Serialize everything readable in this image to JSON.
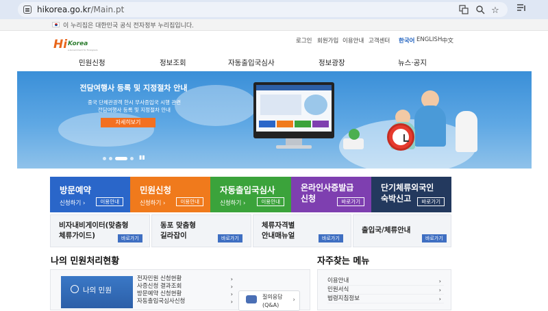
{
  "browser": {
    "url_host": "hikorea.go.kr",
    "url_path": "/Main.pt"
  },
  "gov_notice": "이 누리집은 대한민국 공식 전자정부 누리집입니다.",
  "logo": {
    "hi": "Hi",
    "korea": "Korea",
    "sub": "e-Government for Foreigners"
  },
  "util_links": [
    "로그인",
    "회원가입",
    "이용안내",
    "고객센터"
  ],
  "languages": [
    "한국어",
    "ENGLISH",
    "中文"
  ],
  "gnb": [
    "민원신청",
    "정보조회",
    "자동출입국심사",
    "정보광장",
    "뉴스·공지"
  ],
  "banner": {
    "title": "전담여행사 등록 및 지정절차 안내",
    "desc_line1": "중국 단체관광객 한시 무사증입국 시행 관련",
    "desc_line2": "전담여행사 등록 및 지정절차 안내",
    "button": "자세히보기",
    "play_icon": "pause-icon"
  },
  "tiles_big": [
    {
      "title": "방문예약",
      "sub": "신청하기 ›",
      "btn": "이용안내",
      "color": "#2a66c9"
    },
    {
      "title": "민원신청",
      "sub": "신청하기 ›",
      "btn": "이용안내",
      "color": "#f07a1c"
    },
    {
      "title": "자동출입국심사",
      "sub": "신청하기 ›",
      "btn": "이용안내",
      "color": "#3ba33b"
    },
    {
      "title_line1": "온라인사증발급",
      "title_line2": "신청",
      "btn": "바로가기",
      "color": "#7e3fb0"
    },
    {
      "title_line1": "단기체류외국인",
      "title_line2": "숙박신고",
      "btn": "바로가기",
      "color": "#23395e"
    }
  ],
  "tiles_small": [
    {
      "line1": "비자내비게이터(맞춤형",
      "line2": "체류가이드)",
      "btn": "바로가기"
    },
    {
      "line1": "동포 맞춤형",
      "line2": "길라잡이",
      "btn": "바로가기"
    },
    {
      "line1": "체류자격별",
      "line2": "안내매뉴얼",
      "btn": "바로가기"
    },
    {
      "line1": "출입국/체류안내",
      "line2": "",
      "btn": "바로가기"
    }
  ],
  "my_status": {
    "title": "나의 민원처리현황",
    "box_label": "나의 민원",
    "items": [
      "전자민원 신청현황",
      "사증신청 결과조회",
      "방문예약 신청현황",
      "자동출입국심사신청"
    ],
    "qna_line1": "질의응답",
    "qna_line2": "(Q&A)"
  },
  "favorites": {
    "title": "자주찾는 메뉴",
    "items": [
      "이용안내",
      "민원서식",
      "법령지침정보"
    ]
  },
  "colors": {
    "brand_blue": "#2a66c9",
    "accent_orange": "#f37021"
  }
}
